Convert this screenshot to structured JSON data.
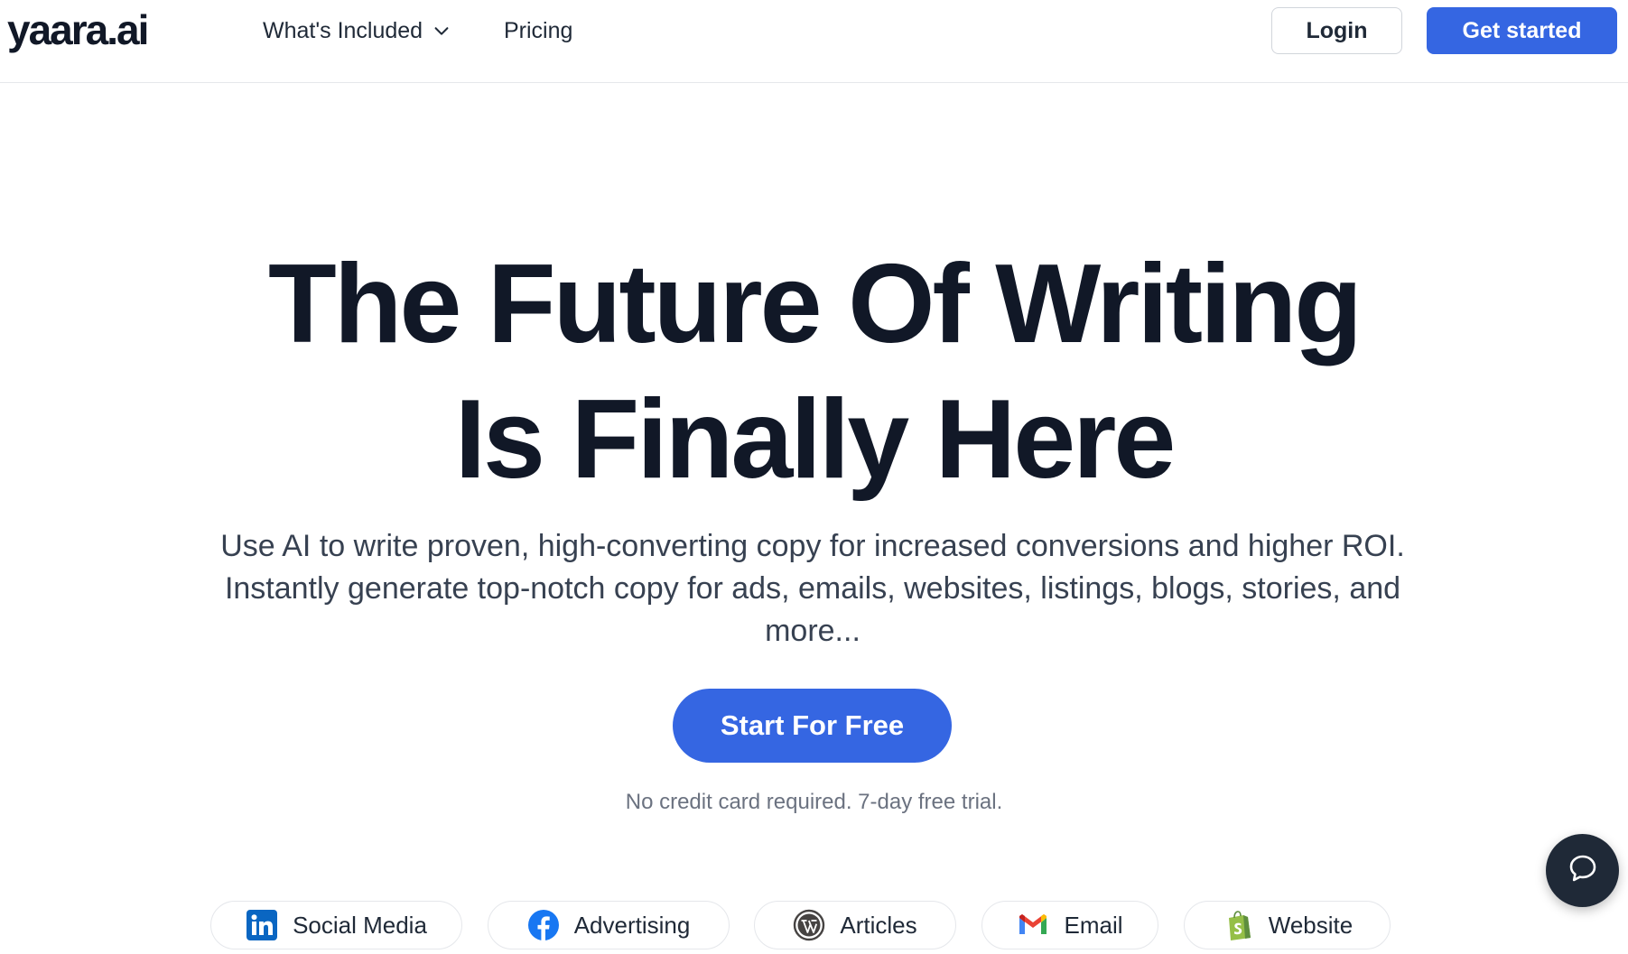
{
  "header": {
    "logo": "yaara.ai",
    "nav": [
      {
        "label": "What's Included",
        "has_dropdown": true
      },
      {
        "label": "Pricing",
        "has_dropdown": false
      }
    ],
    "login_label": "Login",
    "get_started_label": "Get started"
  },
  "hero": {
    "title_line1": "The Future Of Writing",
    "title_line2": "Is Finally Here",
    "subtitle": "Use AI to write proven, high-converting copy for increased conversions and higher ROI. Instantly generate top-notch copy for ads, emails, websites, listings, blogs, stories, and more...",
    "cta_label": "Start For Free",
    "note": "No credit card required. 7-day free trial."
  },
  "categories": [
    {
      "label": "Social Media",
      "icon": "linkedin-icon"
    },
    {
      "label": "Advertising",
      "icon": "facebook-icon"
    },
    {
      "label": "Articles",
      "icon": "wordpress-icon"
    },
    {
      "label": "Email",
      "icon": "gmail-icon"
    },
    {
      "label": "Website",
      "icon": "shopify-icon"
    }
  ],
  "colors": {
    "accent": "#3566e2",
    "text": "#111827",
    "chat_bubble": "#1f2937"
  },
  "chat_widget": {
    "icon": "chat-bubble-icon"
  }
}
